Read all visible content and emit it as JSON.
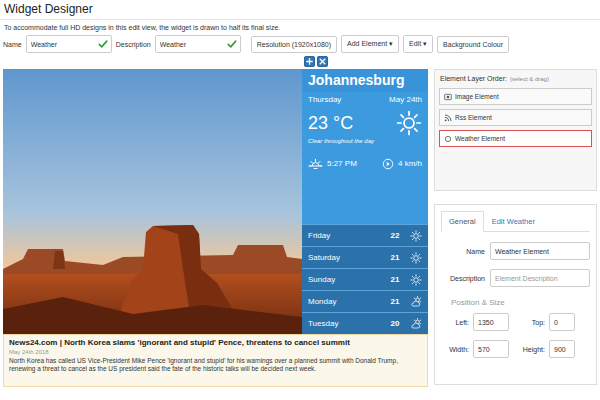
{
  "header": {
    "title": "Widget Designer",
    "note": "To accommodate full HD designs in this edit view, the widget is drawn to half its final size."
  },
  "toolbar": {
    "name": {
      "label": "Name",
      "value": "Weather",
      "valid": true
    },
    "description": {
      "label": "Description",
      "value": "Weather",
      "valid": true
    },
    "buttons": [
      "Resolution (1920x1080)",
      "Add Element ▾",
      "Edit ▾",
      "Background Colour"
    ]
  },
  "weather": {
    "city": "Johannesburg",
    "day": "Thursday",
    "date": "May 24th",
    "temp": "23 °C",
    "summary": "Clear throughout the day",
    "sunset": "5:27 PM",
    "wind": "4 km/h",
    "forecast": [
      {
        "day": "Friday",
        "temp": "22",
        "kind": "sunny"
      },
      {
        "day": "Saturday",
        "temp": "21",
        "kind": "sunny"
      },
      {
        "day": "Sunday",
        "temp": "21",
        "kind": "sunny"
      },
      {
        "day": "Monday",
        "temp": "21",
        "kind": "cloudy"
      },
      {
        "day": "Tuesday",
        "temp": "20",
        "kind": "cloudy"
      }
    ]
  },
  "news": {
    "title": "News24.com | North Korea slams 'ignorant and stupid' Pence, threatens to cancel summit",
    "date": "May 24th 2018",
    "body": "North Korea has called US Vice-President Mike Pence 'ignorant and stupid' for his warnings over a planned summit with Donald Trump, renewing a threat to cancel as the US president said the fate of the historic talks will be decided next week."
  },
  "layers": {
    "title": "Element Layer Order:",
    "hint": "(select & drag)",
    "items": [
      {
        "label": "Image Element",
        "kind": "image",
        "selected": false
      },
      {
        "label": "Rss Element",
        "kind": "rss",
        "selected": false
      },
      {
        "label": "Weather Element",
        "kind": "weather",
        "selected": true
      }
    ]
  },
  "properties": {
    "tabs": [
      {
        "label": "General",
        "selected": true
      },
      {
        "label": "Edit Weather",
        "selected": false
      }
    ],
    "name": {
      "label": "Name",
      "value": "Weather Element"
    },
    "description": {
      "label": "Description",
      "placeholder": "Element Description"
    },
    "section": "Position & Size",
    "position": [
      {
        "label": "Left:",
        "value": "1350"
      },
      {
        "label": "Top:",
        "value": "0"
      },
      {
        "label": "Width:",
        "value": "570"
      },
      {
        "label": "Height:",
        "value": "900"
      }
    ]
  }
}
